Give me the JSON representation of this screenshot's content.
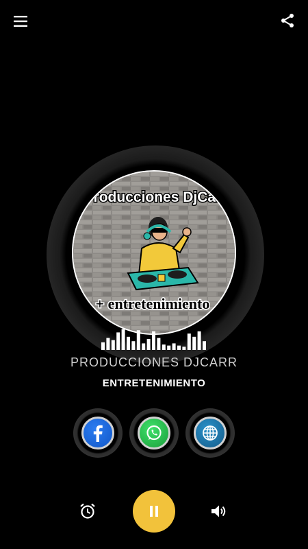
{
  "header": {
    "menu_icon": "menu-icon",
    "share_icon": "share-icon"
  },
  "logo": {
    "top_text": "Producciones DjCarr",
    "bottom_text": "+ entretenimiento"
  },
  "equalizer": {
    "levels": [
      0.35,
      0.55,
      0.45,
      0.8,
      0.95,
      0.6,
      0.4,
      0.9,
      0.3,
      0.5,
      0.85,
      0.55,
      0.25,
      0.2,
      0.3,
      0.2,
      0.15,
      0.75,
      0.6,
      0.85,
      0.4
    ]
  },
  "station": {
    "name": "PRODUCCIONES DJCARR",
    "subtitle": "ENTRETENIMIENTO"
  },
  "social": [
    {
      "name": "facebook",
      "icon": "facebook-icon"
    },
    {
      "name": "whatsapp",
      "icon": "whatsapp-icon"
    },
    {
      "name": "website",
      "icon": "globe-icon"
    }
  ],
  "player": {
    "alarm_icon": "alarm-icon",
    "state_icon": "pause-icon",
    "volume_icon": "volume-icon"
  },
  "colors": {
    "background": "#000000",
    "accent": "#f2c23b",
    "facebook": "#1877f2",
    "whatsapp": "#25d366",
    "web": "#1f7fb8"
  }
}
